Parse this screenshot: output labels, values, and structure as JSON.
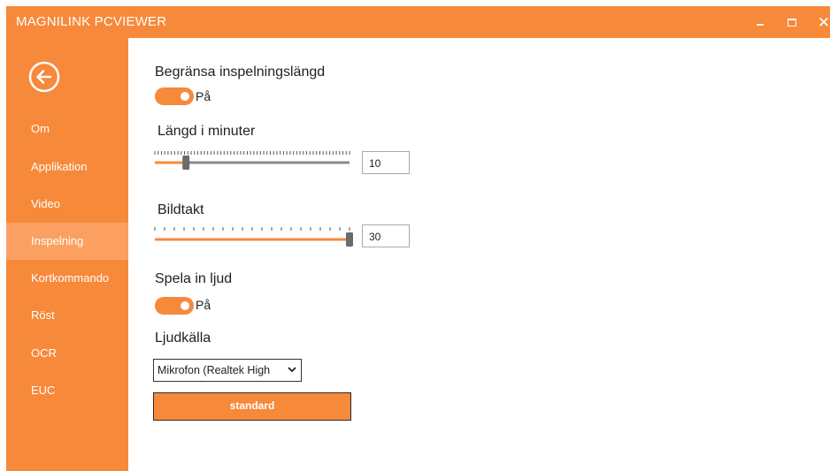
{
  "window": {
    "title": "MAGNILINK PCVIEWER",
    "accent_color": "#f7893a",
    "active_nav_color": "#fba061",
    "controls": {
      "minimize_icon": "minimize-icon",
      "maximize_icon": "maximize-icon",
      "close_icon": "close-icon",
      "close_glyph": "✕"
    }
  },
  "sidebar": {
    "back_icon": "back-arrow-icon",
    "items": [
      {
        "label": "Om",
        "active": false
      },
      {
        "label": "Applikation",
        "active": false
      },
      {
        "label": "Video",
        "active": false
      },
      {
        "label": "Inspelning",
        "active": true
      },
      {
        "label": "Kortkommando",
        "active": false
      },
      {
        "label": "Röst",
        "active": false
      },
      {
        "label": "OCR",
        "active": false
      },
      {
        "label": "EUC",
        "active": false
      }
    ]
  },
  "settings": {
    "limit_recording": {
      "label": "Begränsa inspelningslängd",
      "toggle_state": "on",
      "toggle_text": "På"
    },
    "length_minutes": {
      "label": "Längd i minuter",
      "value": "10",
      "slider_fraction": 0.16
    },
    "frame_rate": {
      "label": "Bildtakt",
      "value": "30",
      "slider_fraction": 1.0
    },
    "record_audio": {
      "label": "Spela in ljud",
      "toggle_state": "on",
      "toggle_text": "På"
    },
    "audio_source": {
      "label": "Ljudkälla",
      "selected": "Mikrofon (Realtek High"
    },
    "reset_button": "standard"
  }
}
